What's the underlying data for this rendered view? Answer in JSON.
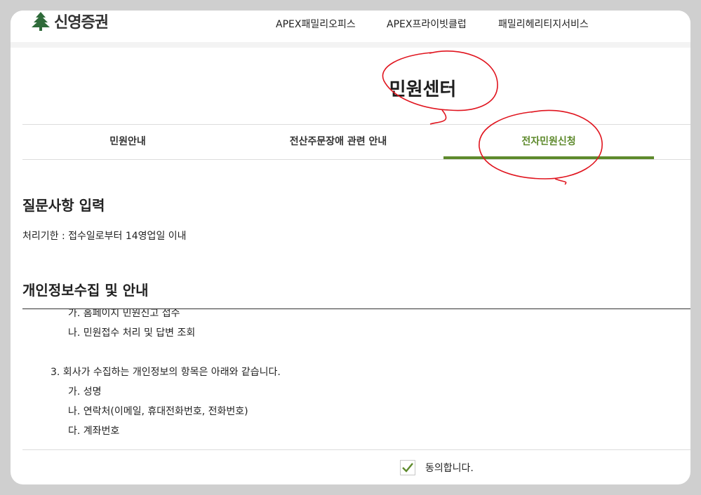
{
  "header": {
    "logo_text": "신영증권",
    "nav": [
      "APEX패밀리오피스",
      "APEX프라이빗클럽",
      "패밀리헤리티지서비스"
    ]
  },
  "page_title": "민원센터",
  "tabs": [
    {
      "label": "민원안내",
      "active": false
    },
    {
      "label": "전산주문장애 관련 안내",
      "active": false
    },
    {
      "label": "전자민원신청",
      "active": true
    }
  ],
  "colors": {
    "accent": "#5e8a2c",
    "annotation": "#e0141e"
  },
  "question_section": {
    "title": "질문사항 입력",
    "deadline": "처리기한 : 접수일로부터 14영업일 이내"
  },
  "privacy_section": {
    "title": "개인정보수집 및 안내",
    "lines": [
      "가. 홈페이지 민원신고 접수",
      "나. 민원접수 처리 및 답변 조회",
      "3.  회사가 수집하는 개인정보의 항목은 아래와 같습니다.",
      "가. 성명",
      "나. 연락처(이메일, 휴대전화번호, 전화번호)",
      "다. 계좌번호"
    ]
  },
  "agree": {
    "label": "동의합니다.",
    "checked": true
  },
  "icons": {
    "logo": "pine-tree-icon",
    "check": "check-icon"
  }
}
